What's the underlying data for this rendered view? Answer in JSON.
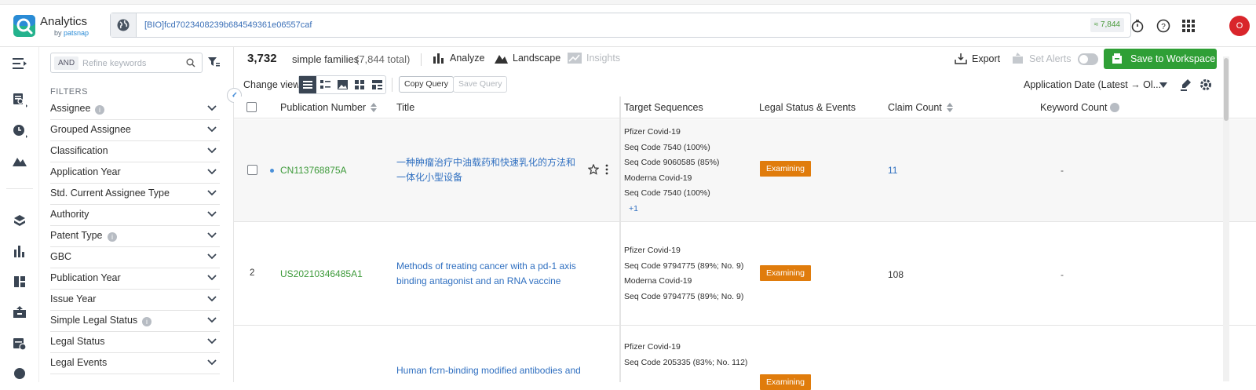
{
  "app": {
    "title": "Analytics",
    "byline_prefix": "by ",
    "byline_brand": "patsnap"
  },
  "search": {
    "query": "[BIO]fcd7023408239b684549361e06557caf",
    "result_count": "≈ 7,844"
  },
  "user": {
    "avatar_initial": "O"
  },
  "filters": {
    "logic": "AND",
    "keyword_placeholder": "Refine keywords",
    "title": "FILTERS",
    "items": [
      {
        "label": "Assignee",
        "info": true
      },
      {
        "label": "Grouped Assignee",
        "info": false
      },
      {
        "label": "Classification",
        "info": false
      },
      {
        "label": "Application Year",
        "info": false
      },
      {
        "label": "Std. Current Assignee Type",
        "info": false
      },
      {
        "label": "Authority",
        "info": false
      },
      {
        "label": "Patent Type",
        "info": true
      },
      {
        "label": "GBC",
        "info": false
      },
      {
        "label": "Publication Year",
        "info": false
      },
      {
        "label": "Issue Year",
        "info": false
      },
      {
        "label": "Simple Legal Status",
        "info": true
      },
      {
        "label": "Legal Status",
        "info": false
      },
      {
        "label": "Legal Events",
        "info": false
      }
    ]
  },
  "summary": {
    "count": "3,732",
    "unit": "simple families",
    "total": "(7,844 total)",
    "analyze": "Analyze",
    "landscape": "Landscape",
    "insights": "Insights",
    "export": "Export",
    "set_alerts": "Set Alerts",
    "save_workspace": "Save to Workspace"
  },
  "view": {
    "change_view": "Change view",
    "copy_query": "Copy Query",
    "save_query": "Save Query",
    "sort": "Application Date (Latest → Ol..."
  },
  "table": {
    "columns": {
      "publication_number": "Publication Number",
      "title": "Title",
      "target_sequences": "Target Sequences",
      "legal_status": "Legal Status & Events",
      "claim_count": "Claim Count",
      "keyword_count": "Keyword Count"
    },
    "rows": [
      {
        "num": "",
        "pub": "CN113768875A",
        "title": "一种肿瘤治疗中油载药和快速乳化的方法和一体化小型设备",
        "seqs": [
          "Pfizer Covid-19",
          "Seq Code 7540 (100%)",
          "Seq Code 9060585 (85%)",
          "Moderna Covid-19",
          "Seq Code 7540 (100%)"
        ],
        "more": "+1",
        "status": "Examining",
        "claims": "11",
        "keywords": "-"
      },
      {
        "num": "2",
        "pub": "US20210346485A1",
        "title": "Methods of treating cancer with a pd-1 axis binding antagonist and an RNA vaccine",
        "seqs": [
          "Pfizer Covid-19",
          "Seq Code 9794775 (89%; No. 9)",
          "Moderna Covid-19",
          "Seq Code 9794775 (89%; No. 9)"
        ],
        "status": "Examining",
        "claims": "108",
        "keywords": "-"
      },
      {
        "num": "",
        "pub": "",
        "title": "Human fcrn-binding modified antibodies and",
        "seqs": [
          "Pfizer Covid-19",
          "Seq Code 205335 (83%; No. 112)"
        ],
        "status": "Examining",
        "claims": "",
        "keywords": ""
      }
    ]
  },
  "colors": {
    "accent_green": "#2f9f36",
    "status_orange": "#e07c0c",
    "link_blue": "#2f6fc0",
    "pub_green": "#3d9a3a"
  }
}
